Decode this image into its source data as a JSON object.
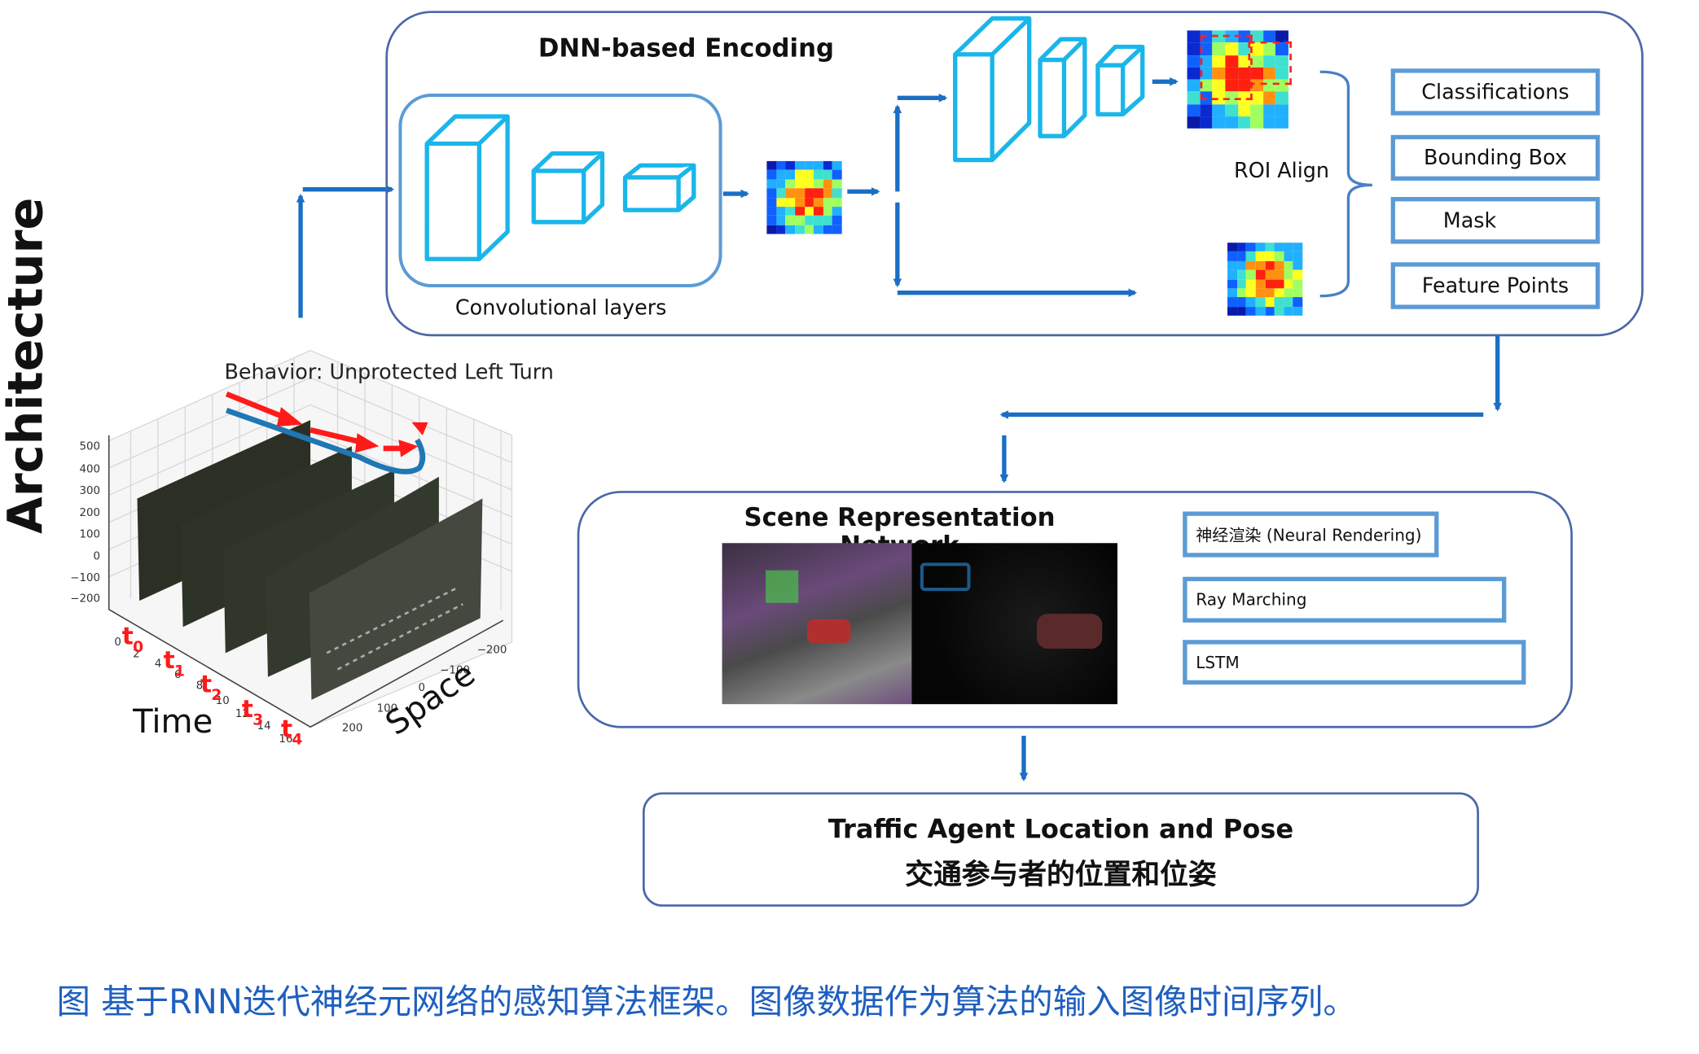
{
  "side_label": "Architecture",
  "encoding": {
    "title": "DNN-based Encoding",
    "conv_label": "Convolutional layers",
    "roi_label": "ROI Align",
    "outputs": [
      "Classifications",
      "Bounding Box",
      "Mask",
      "Feature Points"
    ]
  },
  "plot3d": {
    "title": "Behavior: Unprotected Left Turn",
    "z_ticks": [
      "500",
      "400",
      "300",
      "200",
      "100",
      "0",
      "−100",
      "−200"
    ],
    "time_ticks": [
      "0",
      "2",
      "4",
      "6",
      "8",
      "10",
      "12",
      "14",
      "16"
    ],
    "time_markers": [
      "t",
      "t",
      "t",
      "t",
      "t"
    ],
    "time_marker_subs": [
      "0",
      "1",
      "2",
      "3",
      "4"
    ],
    "space_ticks": [
      "−200",
      "−100",
      "0",
      "100",
      "200"
    ],
    "time_label": "Time",
    "space_label": "Space"
  },
  "scene": {
    "title": "Scene Representation Network",
    "items": [
      "神经渲染 (Neural Rendering)",
      "Ray Marching",
      "LSTM"
    ]
  },
  "result": {
    "line1": "Traffic Agent Location and Pose",
    "line2": "交通参与者的位置和位姿"
  },
  "caption": "图 基于RNN迭代神经元网络的感知算法框架。图像数据作为算法的输入图像时间序列。",
  "colors": {
    "arrow": "#1a6fc4",
    "cube": "#1ab6ea",
    "box_border": "#5b9bd5",
    "frame": "#4a67a8",
    "caption": "#1f5fbf",
    "red": "#ff1a1a"
  }
}
